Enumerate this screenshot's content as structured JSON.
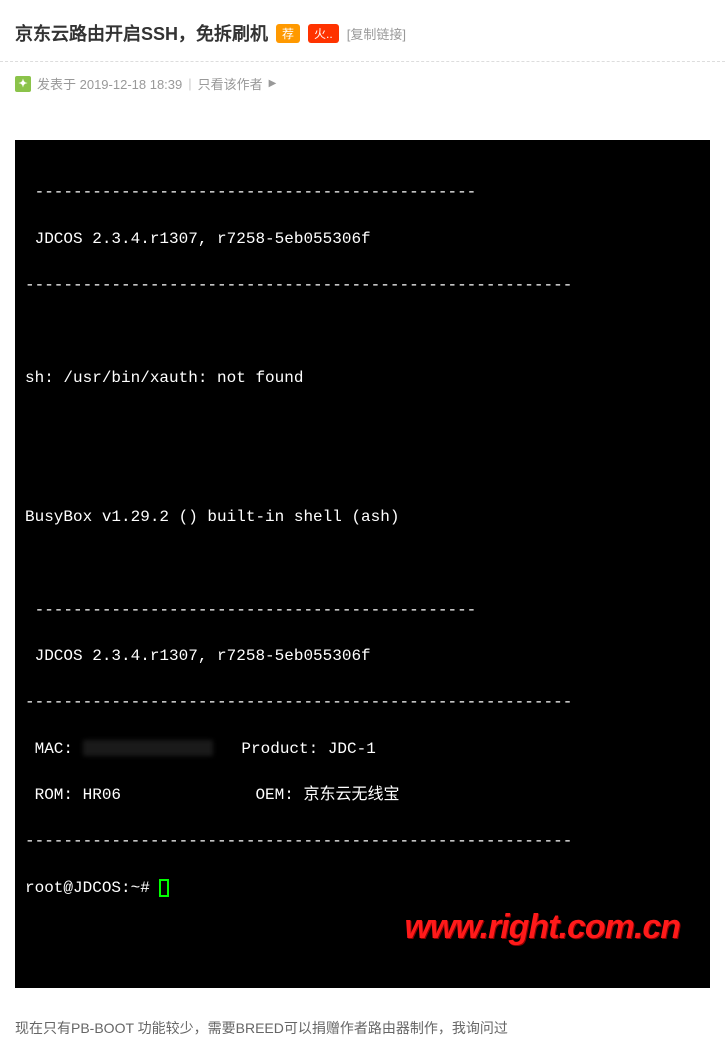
{
  "header": {
    "title": "京东云路由开启SSH，免拆刷机",
    "badge1": "荐",
    "badge2": "火..",
    "copy_link": "[复制链接]"
  },
  "meta": {
    "posted": "发表于 2019-12-18 18:39",
    "author_only": "只看该作者"
  },
  "terminal": {
    "dash1": " ----------------------------------------------",
    "jdcos1": " JDCOS 2.3.4.r1307, r7258-5eb055306f",
    "dash2": "---------------------------------------------------------",
    "xauth": "sh: /usr/bin/xauth: not found",
    "busybox": "BusyBox v1.29.2 () built-in shell (ash)",
    "dash3": " ----------------------------------------------",
    "jdcos2": " JDCOS 2.3.4.r1307, r7258-5eb055306f",
    "dash4": "---------------------------------------------------------",
    "mac_label": " MAC: ",
    "product": "   Product: JDC-1",
    "rom": " ROM: HR06              OEM: 京东云无线宝",
    "dash5": "---------------------------------------------------------",
    "prompt": "root@JDCOS:~# "
  },
  "watermark": "www.right.com.cn",
  "note": "现在只有PB-BOOT 功能较少，需要BREED可以捐赠作者路由器制作，我询问过"
}
